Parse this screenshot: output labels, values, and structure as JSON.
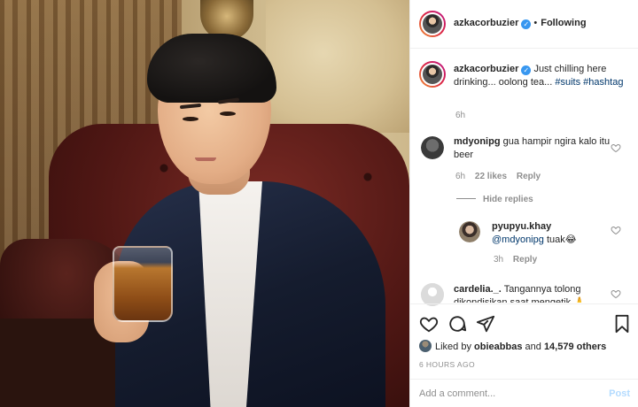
{
  "post": {
    "author": "azkacorbuzier",
    "follow_separator": "•",
    "follow_status": "Following",
    "caption_text": "Just chilling here drinking... oolong tea...",
    "caption_tags": [
      "#suits",
      "#hashtag"
    ],
    "caption_age": "6h",
    "photo_description": "photo"
  },
  "comments": [
    {
      "author": "mdyonipg",
      "text": "gua hampir ngira kalo itu beer",
      "age": "6h",
      "likes": "22 likes",
      "reply_label": "Reply",
      "hide_replies_label": "Hide replies",
      "replies": [
        {
          "author": "pyupyu.khay",
          "mention": "@mdyonipg",
          "text": "tuak😂",
          "age": "3h",
          "reply_label": "Reply"
        }
      ]
    },
    {
      "author": "cardelia._.",
      "text": "Tangannya tolong dikondisikan saat mengetik 🙏"
    }
  ],
  "actions": {
    "like_icon": "heart-icon",
    "comment_icon": "comment-icon",
    "share_icon": "share-icon",
    "save_icon": "bookmark-icon"
  },
  "likes": {
    "prefix": "Liked by",
    "user": "obieabbas",
    "conjunction": "and",
    "others": "14,579 others"
  },
  "timestamp": "6 HOURS AGO",
  "add_comment": {
    "placeholder": "Add a comment...",
    "post_label": "Post"
  },
  "colors": {
    "verified": "#3897f0",
    "link": "#00376b",
    "muted": "#8e8e8e",
    "post_disabled": "#b3dbff"
  }
}
